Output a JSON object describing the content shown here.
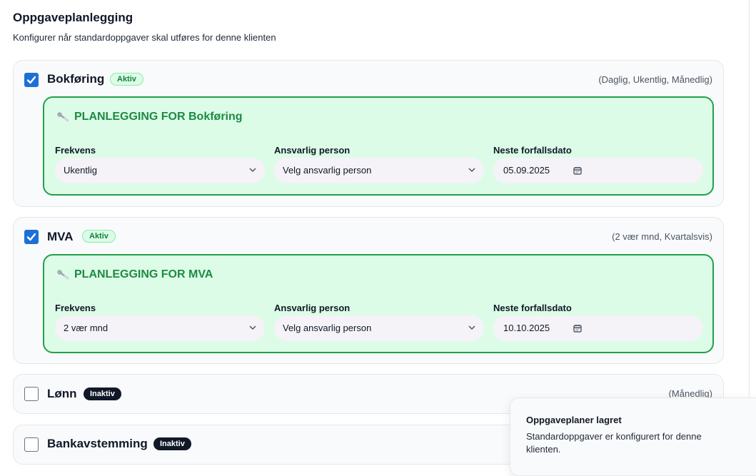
{
  "page": {
    "title": "Oppgaveplanlegging",
    "subtitle": "Konfigurer når standardoppgaver skal utføres for denne klienten"
  },
  "labels": {
    "frequency": "Frekvens",
    "responsible": "Ansvarlig person",
    "next_due": "Neste forfallsdato"
  },
  "tasks": [
    {
      "name": "Bokføring",
      "checked": true,
      "status": "Aktiv",
      "frequency_options": "(Daglig, Ukentlig, Månedlig)",
      "panel_title": "PLANLEGGING FOR Bokføring",
      "frequency": "Ukentlig",
      "responsible": "Velg ansvarlig person",
      "next_due": "05.09.2025"
    },
    {
      "name": "MVA",
      "checked": true,
      "status": "Aktiv",
      "frequency_options": "(2 vær mnd, Kvartalsvis)",
      "panel_title": "PLANLEGGING FOR MVA",
      "frequency": "2 vær mnd",
      "responsible": "Velg ansvarlig person",
      "next_due": "10.10.2025"
    },
    {
      "name": "Lønn",
      "checked": false,
      "status": "Inaktiv",
      "frequency_options": "(Månedlig)"
    },
    {
      "name": "Bankavstemming",
      "checked": false,
      "status": "Inaktiv"
    }
  ],
  "toast": {
    "title": "Oppgaveplaner lagret",
    "message": "Standardoppgaver er konfigurert for denne klienten."
  },
  "colors": {
    "accent_blue": "#1d6fd8",
    "active_green": "#22a04b",
    "panel_bg": "#dcfce7",
    "inactive_badge": "#111827"
  },
  "icons": [
    "checkbox-checked-icon",
    "wrench-icon",
    "chevron-down-icon",
    "calendar-icon"
  ]
}
